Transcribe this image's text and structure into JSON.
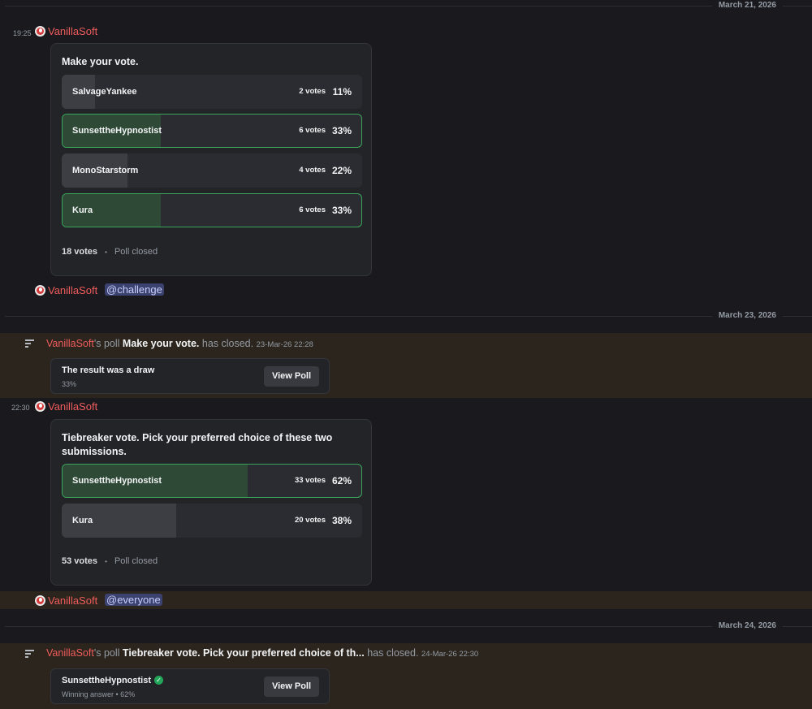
{
  "dates": [
    "March 21, 2026",
    "March 23, 2026",
    "March 24, 2026"
  ],
  "colors": {
    "background": "#1a1a1e",
    "highlight": "#2b251d",
    "username": "#f05c5c",
    "winner_border": "#3ba55c",
    "mention_bg": "#3c4270"
  },
  "msg1": {
    "time": "19:25",
    "author": "VanillaSoft",
    "poll": {
      "question": "Make your vote.",
      "options": [
        {
          "name": "SalvageYankee",
          "votes": "2 votes",
          "pct": "11%",
          "share": 0.11,
          "winner": false
        },
        {
          "name": "SunsettheHypnostist",
          "votes": "6 votes",
          "pct": "33%",
          "share": 0.33,
          "winner": true
        },
        {
          "name": "MonoStarstorm",
          "votes": "4 votes",
          "pct": "22%",
          "share": 0.22,
          "winner": false
        },
        {
          "name": "Kura",
          "votes": "6 votes",
          "pct": "33%",
          "share": 0.33,
          "winner": true
        }
      ],
      "total": "18 votes",
      "sep": "•",
      "status": "Poll closed"
    }
  },
  "msg2": {
    "author": "VanillaSoft",
    "mention": "@challenge"
  },
  "sys1": {
    "who": "VanillaSoft",
    "mid": "'s poll",
    "question": "Make your vote.",
    "closed": "has closed.",
    "when": "23-Mar-26 22:28",
    "result_title": "The result was a draw",
    "result_sub": "33%",
    "button": "View Poll"
  },
  "msg3": {
    "time": "22:30",
    "author": "VanillaSoft",
    "poll": {
      "question": "Tiebreaker vote. Pick your preferred choice of these two submissions.",
      "options": [
        {
          "name": "SunsettheHypnostist",
          "votes": "33 votes",
          "pct": "62%",
          "share": 0.62,
          "winner": true
        },
        {
          "name": "Kura",
          "votes": "20 votes",
          "pct": "38%",
          "share": 0.38,
          "winner": false
        }
      ],
      "total": "53 votes",
      "sep": "•",
      "status": "Poll closed"
    }
  },
  "msg4": {
    "author": "VanillaSoft",
    "mention": "@everyone"
  },
  "sys2": {
    "who": "VanillaSoft",
    "mid": "'s poll",
    "question": "Tiebreaker vote. Pick your preferred choice of th...",
    "closed": "has closed.",
    "when": "24-Mar-26 22:30",
    "result_title": "SunsettheHypnostist",
    "result_sub": "Winning answer • 62%",
    "button": "View Poll",
    "check_icon": "check-circle-icon"
  }
}
